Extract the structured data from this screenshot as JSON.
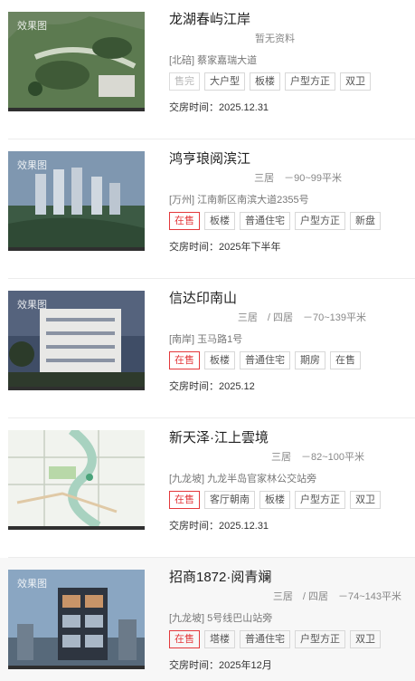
{
  "watermark": "效果图",
  "listings": [
    {
      "name": "龙湖春屿江岸",
      "meta": "暂无资料",
      "address": "[北碚] 蔡家嘉瑞大道",
      "tags": [
        "售完",
        "大户型",
        "板楼",
        "户型方正",
        "双卫"
      ],
      "delivery": "交房时间：2025.12.31"
    },
    {
      "name": "鸿亨琅阅滨江",
      "meta": "三居　－90~99平米",
      "address": "[万州] 江南新区南滨大道2355号",
      "tags": [
        "在售",
        "板楼",
        "普通住宅",
        "户型方正",
        "新盘"
      ],
      "delivery": "交房时间：2025年下半年"
    },
    {
      "name": "信达印南山",
      "meta": "三居　/ 四居　－70~139平米",
      "address": "[南岸] 玉马路1号",
      "tags": [
        "在售",
        "板楼",
        "普通住宅",
        "期房",
        "在售"
      ],
      "delivery": "交房时间：2025.12"
    },
    {
      "name": "新天泽·江上雲境",
      "meta": "三居　－82~100平米",
      "address": "[九龙坡] 九龙半岛官家林公交站旁",
      "tags": [
        "在售",
        "客厅朝南",
        "板楼",
        "户型方正",
        "双卫"
      ],
      "delivery": "交房时间：2025.12.31"
    },
    {
      "name": "招商1872·阅青斓",
      "meta": "三居　/ 四居　－74~143平米",
      "address": "[九龙坡] 5号线巴山站旁",
      "tags": [
        "在售",
        "塔楼",
        "普通住宅",
        "户型方正",
        "双卫"
      ],
      "delivery": "交房时间：2025年12月"
    }
  ],
  "colors": {
    "status_on_sale": "#e3393c",
    "status_sold_out": "#b8b8b8"
  }
}
